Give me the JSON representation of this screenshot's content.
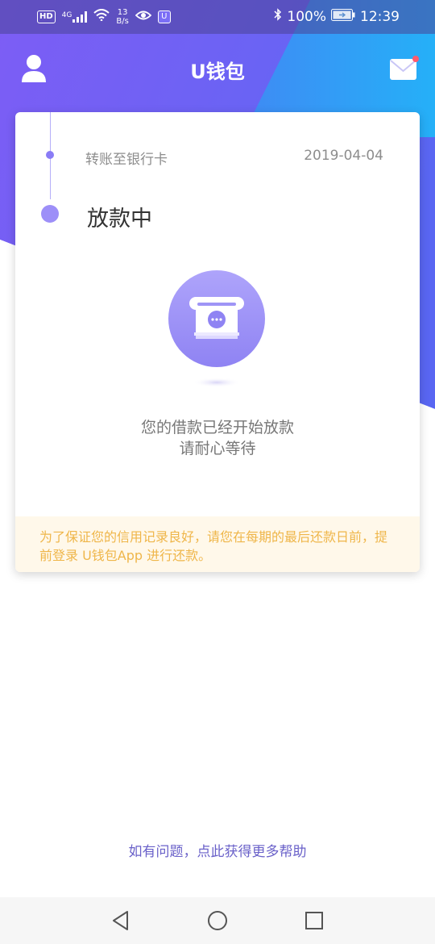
{
  "status_bar": {
    "hd_badge": "HD",
    "network_type": "4G",
    "data_speed_value": "13",
    "data_speed_unit": "B/s",
    "app_badge": "U",
    "battery_percent": "100%",
    "time": "12:39",
    "icons": [
      "signal-icon",
      "wifi-icon",
      "eye-icon",
      "bluetooth-icon",
      "battery-icon"
    ]
  },
  "header": {
    "title": "U钱包",
    "left_icon": "user-avatar-icon",
    "right_icon": "mail-icon",
    "mail_unread": true
  },
  "progress": {
    "steps": [
      {
        "label": "转账至银行卡",
        "date": "2019-04-04",
        "current": false
      },
      {
        "label": "放款中",
        "current": true
      }
    ]
  },
  "status_message": {
    "line1": "您的借款已经开始放款",
    "line2": "请耐心等待",
    "illustration": "atm-card-slot-icon"
  },
  "notice": {
    "text": "为了保证您的信用记录良好，请您在每期的最后还款日前，提前登录 U钱包App 进行还款。"
  },
  "help_link": "如有问题，点此获得更多帮助",
  "nav_bar": {
    "buttons": [
      "back-icon",
      "home-icon",
      "recents-icon"
    ]
  },
  "colors": {
    "gradient_start": "#7d5df5",
    "gradient_end": "#2fa0f5",
    "accent": "#8a7cf6",
    "notice_text": "#efb64a",
    "notice_bg": "#fff8ea",
    "link": "#6a61c9",
    "unread_dot": "#ff5a6e"
  }
}
